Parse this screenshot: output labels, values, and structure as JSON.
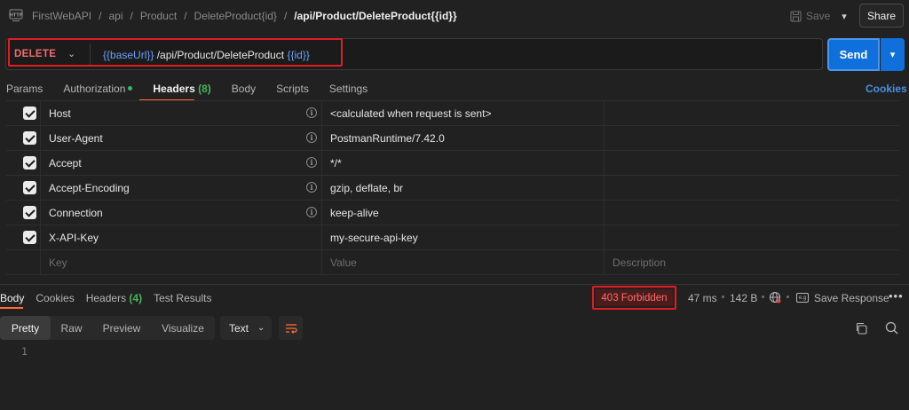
{
  "breadcrumb": {
    "items": [
      "FirstWebAPI",
      "api",
      "Product",
      "DeleteProduct{id}"
    ],
    "separator": "/",
    "current": "/api/Product/DeleteProduct{{id}}"
  },
  "header": {
    "save_label": "Save",
    "share_label": "Share"
  },
  "request": {
    "method": "DELETE",
    "url_var_base": "{{baseUrl}}",
    "url_path": " /api/Product/DeleteProduct ",
    "url_var_id": "{{id}}",
    "send_label": "Send"
  },
  "request_tabs": {
    "params": "Params",
    "authorization": "Authorization",
    "headers": "Headers",
    "headers_count": "(8)",
    "body": "Body",
    "scripts": "Scripts",
    "settings": "Settings",
    "cookies": "Cookies"
  },
  "headers_table": {
    "rows": [
      {
        "key": "Host",
        "value": "<calculated when request is sent>"
      },
      {
        "key": "User-Agent",
        "value": "PostmanRuntime/7.42.0"
      },
      {
        "key": "Accept",
        "value": "*/*"
      },
      {
        "key": "Accept-Encoding",
        "value": "gzip, deflate, br"
      },
      {
        "key": "Connection",
        "value": "keep-alive"
      },
      {
        "key": "X-API-Key",
        "value": "my-secure-api-key"
      }
    ],
    "placeholder_key": "Key",
    "placeholder_value": "Value",
    "placeholder_description": "Description"
  },
  "response_tabs": {
    "body": "Body",
    "cookies": "Cookies",
    "headers": "Headers",
    "headers_count": "(4)",
    "test_results": "Test Results"
  },
  "response": {
    "status": "403 Forbidden",
    "time": "47 ms",
    "size": "142 B",
    "save_response": "Save Response",
    "line_number": "1"
  },
  "view_modes": {
    "pretty": "Pretty",
    "raw": "Raw",
    "preview": "Preview",
    "visualize": "Visualize",
    "format": "Text"
  },
  "colors": {
    "accent_orange": "#ff6c37",
    "send_blue": "#0f6fdb",
    "method_red": "#f26b6b",
    "variable_blue": "#6aa1ff",
    "status_red": "#ff6e6e",
    "annotation_red": "#e21c23"
  },
  "icons": {
    "http": "http-icon",
    "save": "floppy-disk-icon",
    "info": "info-icon",
    "globe": "globe-icon",
    "copy": "copy-icon",
    "search": "search-icon",
    "wrap": "wrap-lines-icon"
  }
}
